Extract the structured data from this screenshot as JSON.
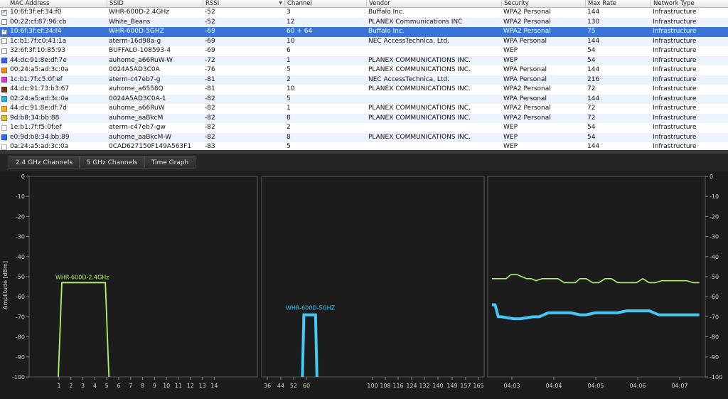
{
  "table": {
    "columns": [
      {
        "label": "MAC Address"
      },
      {
        "label": "SSID"
      },
      {
        "label": "RSSI"
      },
      {
        "label": "Channel"
      },
      {
        "label": "Vendor"
      },
      {
        "label": "Security"
      },
      {
        "label": "Max Rate"
      },
      {
        "label": "Network Type"
      }
    ],
    "rows": [
      {
        "checked": true,
        "color": "",
        "mac": "10:6f:3f:ef:34:f0",
        "ssid": "WHR-600D-2.4GHz",
        "rssi": "-52",
        "channel": "3",
        "vendor": "Buffalo Inc.",
        "security": "WPA2 Personal",
        "max_rate": "144",
        "type": "Infrastructure"
      },
      {
        "checked": false,
        "color": "",
        "mac": "00:22:cf:87:96:cb",
        "ssid": "White_Beans",
        "rssi": "-52",
        "channel": "12",
        "vendor": "PLANEX Communications INC",
        "security": "WPA2 Personal",
        "max_rate": "130",
        "type": "Infrastructure"
      },
      {
        "checked": true,
        "color": "",
        "mac": "10:6f:3f:ef:34:f4",
        "ssid": "WHR-600D-5GHZ",
        "rssi": "-69",
        "channel": "60 + 64",
        "vendor": "Buffalo Inc.",
        "security": "WPA2 Personal",
        "max_rate": "75",
        "type": "Infrastructure",
        "selected": true
      },
      {
        "checked": false,
        "color": "",
        "mac": "1c:b1:7f:c0:41:1a",
        "ssid": "aterm-16d98a-g",
        "rssi": "-69",
        "channel": "10",
        "vendor": "NEC AccessTechnica, Ltd.",
        "security": "WPA Personal",
        "max_rate": "144",
        "type": "Infrastructure"
      },
      {
        "checked": false,
        "color": "",
        "mac": "32:6f:3f:10:85:93",
        "ssid": "BUFFALO-108593-4",
        "rssi": "-69",
        "channel": "6",
        "vendor": "",
        "security": "WEP",
        "max_rate": "54",
        "type": "Infrastructure"
      },
      {
        "checked": false,
        "color": "#3b5cff",
        "mac": "44:dc:91:8e:df:7e",
        "ssid": "auhome_a66RuW-W",
        "rssi": "-72",
        "channel": "1",
        "vendor": "PLANEX COMMUNICATIONS INC.",
        "security": "WEP",
        "max_rate": "54",
        "type": "Infrastructure"
      },
      {
        "checked": false,
        "color": "#ff8a1e",
        "mac": "00:24:a5:ad:3c:0a",
        "ssid": "0024A5AD3C0A",
        "rssi": "-76",
        "channel": "5",
        "vendor": "PLANEX COMMUNICATIONS INC.",
        "security": "WPA Personal",
        "max_rate": "144",
        "type": "Infrastructure"
      },
      {
        "checked": false,
        "color": "#d63bd9",
        "mac": "1c:b1:7f:c5:0f:ef",
        "ssid": "aterm-c47eb7-g",
        "rssi": "-81",
        "channel": "2",
        "vendor": "NEC AccessTechnica, Ltd.",
        "security": "WPA Personal",
        "max_rate": "216",
        "type": "Infrastructure"
      },
      {
        "checked": false,
        "color": "#7a3a10",
        "mac": "44:dc:91:73:b3:67",
        "ssid": "auhome_a6558Q",
        "rssi": "-81",
        "channel": "10",
        "vendor": "PLANEX COMMUNICATIONS INC.",
        "security": "WPA2 Personal",
        "max_rate": "72",
        "type": "Infrastructure"
      },
      {
        "checked": false,
        "color": "#2bb3e0",
        "mac": "02:24:a5:ad:3c:0a",
        "ssid": "0024A5AD3C0A-1",
        "rssi": "-82",
        "channel": "5",
        "vendor": "",
        "security": "WPA Personal",
        "max_rate": "144",
        "type": "Infrastructure"
      },
      {
        "checked": false,
        "color": "#ffb020",
        "mac": "44:dc:91:8e:df:7d",
        "ssid": "auhome_a66RuW",
        "rssi": "-82",
        "channel": "1",
        "vendor": "PLANEX COMMUNICATIONS INC.",
        "security": "WPA2 Personal",
        "max_rate": "72",
        "type": "Infrastructure"
      },
      {
        "checked": false,
        "color": "#e0c020",
        "mac": "9d:b8:34:bb:88",
        "ssid": "auhome_aaBkcM",
        "rssi": "-82",
        "channel": "8",
        "vendor": "PLANEX COMMUNICATIONS INC.",
        "security": "WPA2 Personal",
        "max_rate": "72",
        "type": "Infrastructure"
      },
      {
        "checked": false,
        "color": "#ffffff",
        "mac": "1e:b1:7f:f5:0f:ef",
        "ssid": "aterm-c47eb7-gw",
        "rssi": "-82",
        "channel": "2",
        "vendor": "",
        "security": "WEP",
        "max_rate": "54",
        "type": "Infrastructure"
      },
      {
        "checked": false,
        "color": "#2a6cf0",
        "mac": "e0:9d:b8:34:bb:89",
        "ssid": "auhome_aaBkcM-W",
        "rssi": "-82",
        "channel": "8",
        "vendor": "PLANEX COMMUNICATIONS INC.",
        "security": "WEP",
        "max_rate": "54",
        "type": "Infrastructure"
      },
      {
        "checked": false,
        "color": "#ffffff",
        "mac": "0a:24:a5:ad:3c:0a",
        "ssid": "0CAD627150F149A563F1",
        "rssi": "-83",
        "channel": "5",
        "vendor": "",
        "security": "WEP",
        "max_rate": "144",
        "type": "Infrastructure"
      }
    ]
  },
  "tabs": [
    {
      "label": "2.4 GHz Channels"
    },
    {
      "label": "5 GHz Channels"
    },
    {
      "label": "Time Graph"
    }
  ],
  "chart_data": [
    {
      "type": "area",
      "ylabel": "Amplitude [dBm]",
      "ylim": [
        -100,
        0
      ],
      "yticks": [
        "0",
        "-10",
        "-20",
        "-30",
        "-40",
        "-50",
        "-60",
        "-70",
        "-80",
        "-90",
        "-100"
      ],
      "xticks": [
        "1",
        "2",
        "3",
        "4",
        "5",
        "6",
        "7",
        "8",
        "9",
        "10",
        "11",
        "12",
        "13",
        "14"
      ],
      "series": [
        {
          "name": "WHR-600D-2.4GHz",
          "color": "#b6f06a",
          "channel_from": 1,
          "channel_to": 5,
          "peak_dbm": -53
        }
      ]
    },
    {
      "type": "area",
      "ylim": [
        -100,
        0
      ],
      "xticks": [
        "36",
        "44",
        "52",
        "60",
        "100",
        "108",
        "116",
        "124",
        "132",
        "140",
        "149",
        "157",
        "165"
      ],
      "series": [
        {
          "name": "WHR-600D-5GHZ",
          "color": "#44c8f5",
          "channel_from": 58,
          "channel_to": 66,
          "peak_dbm": -69
        }
      ]
    },
    {
      "type": "line",
      "ylim": [
        -100,
        0
      ],
      "yticks": [
        "0",
        "-10",
        "-20",
        "-30",
        "-40",
        "-50",
        "-60",
        "-70",
        "-80",
        "-90",
        "-100"
      ],
      "xticks": [
        "04:03",
        "04:04",
        "04:05",
        "04:06",
        "04:07"
      ],
      "series": [
        {
          "color": "#b6f06a",
          "x": [
            0,
            0.6,
            0.9,
            1.2,
            1.6,
            1.9,
            2.2,
            2.5,
            2.8,
            3.2,
            3.6,
            3.9,
            4.2,
            4.6,
            5.0,
            5.3,
            5.6,
            6.0,
            6.4,
            6.8,
            7.2,
            7.6,
            8.0,
            8.4,
            8.8,
            9.2,
            9.6,
            10.0,
            10.4,
            10.8,
            11.2,
            11.6,
            12.0,
            12.4,
            12.8,
            13.2
          ],
          "y": [
            -51,
            -51,
            -51,
            -49,
            -49,
            -50,
            -51,
            -51,
            -52,
            -51,
            -51,
            -51,
            -51,
            -53,
            -53,
            -53,
            -51,
            -51,
            -53,
            -53,
            -51,
            -51,
            -53,
            -53,
            -53,
            -53,
            -51,
            -53,
            -53,
            -52,
            -52,
            -52,
            -52,
            -52,
            -53,
            -53
          ]
        },
        {
          "color": "#44c8f5",
          "x": [
            0,
            0.2,
            0.4,
            0.6,
            1.4,
            1.8,
            2.6,
            3.0,
            3.6,
            4.0,
            4.6,
            5.0,
            5.6,
            6.0,
            6.6,
            7.0,
            7.6,
            8.0,
            8.6,
            9.0,
            9.6,
            10.0,
            10.6,
            11.0,
            11.6,
            12.0,
            12.6,
            13.2
          ],
          "y": [
            -64,
            -64,
            -70,
            -70,
            -71,
            -71,
            -70,
            -70,
            -68,
            -68,
            -68,
            -68,
            -69,
            -69,
            -68,
            -68,
            -68,
            -68,
            -67,
            -67,
            -67,
            -67,
            -69,
            -69,
            -69,
            -69,
            -69,
            -69
          ]
        }
      ]
    }
  ]
}
